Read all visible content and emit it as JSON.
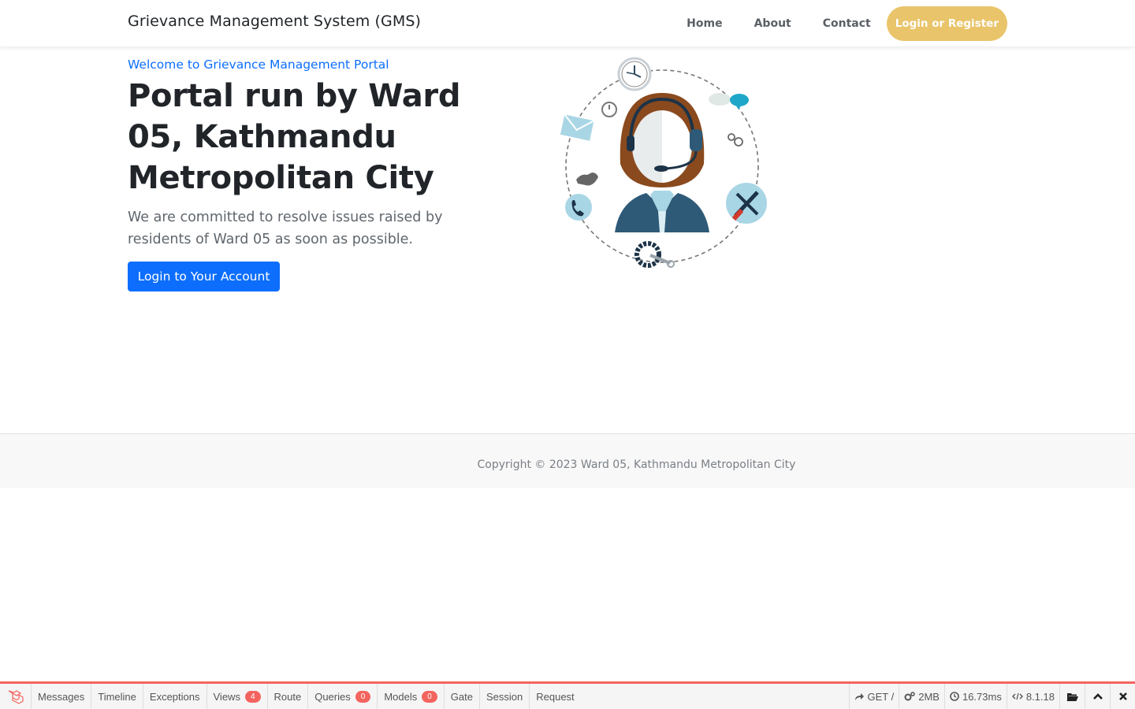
{
  "navbar": {
    "brand": "Grievance Management System (GMS)",
    "links": [
      "Home",
      "About",
      "Contact"
    ],
    "cta": "Login or Register"
  },
  "hero": {
    "welcome": "Welcome to Grievance Management Portal",
    "headline": "Portal run by Ward 05, Kathmandu Metropolitan City",
    "lead": "We are committed to resolve issues raised by residents of Ward 05 as soon as possible.",
    "button": "Login to Your Account"
  },
  "footer": {
    "copyright": "Copyright © 2023 Ward 05, Kathmandu Metropolitan City"
  },
  "debugbar": {
    "tabs": [
      {
        "label": "Messages"
      },
      {
        "label": "Timeline"
      },
      {
        "label": "Exceptions"
      },
      {
        "label": "Views",
        "badge": "4"
      },
      {
        "label": "Route"
      },
      {
        "label": "Queries",
        "badge": "0"
      },
      {
        "label": "Models",
        "badge": "0"
      },
      {
        "label": "Gate"
      },
      {
        "label": "Session"
      },
      {
        "label": "Request"
      }
    ],
    "request": "GET /",
    "memory": "2MB",
    "time": "16.73ms",
    "php_version": "8.1.18"
  },
  "colors": {
    "primary": "#0d6efd",
    "cta": "#e9c46a",
    "debug_accent": "#f4645f"
  }
}
